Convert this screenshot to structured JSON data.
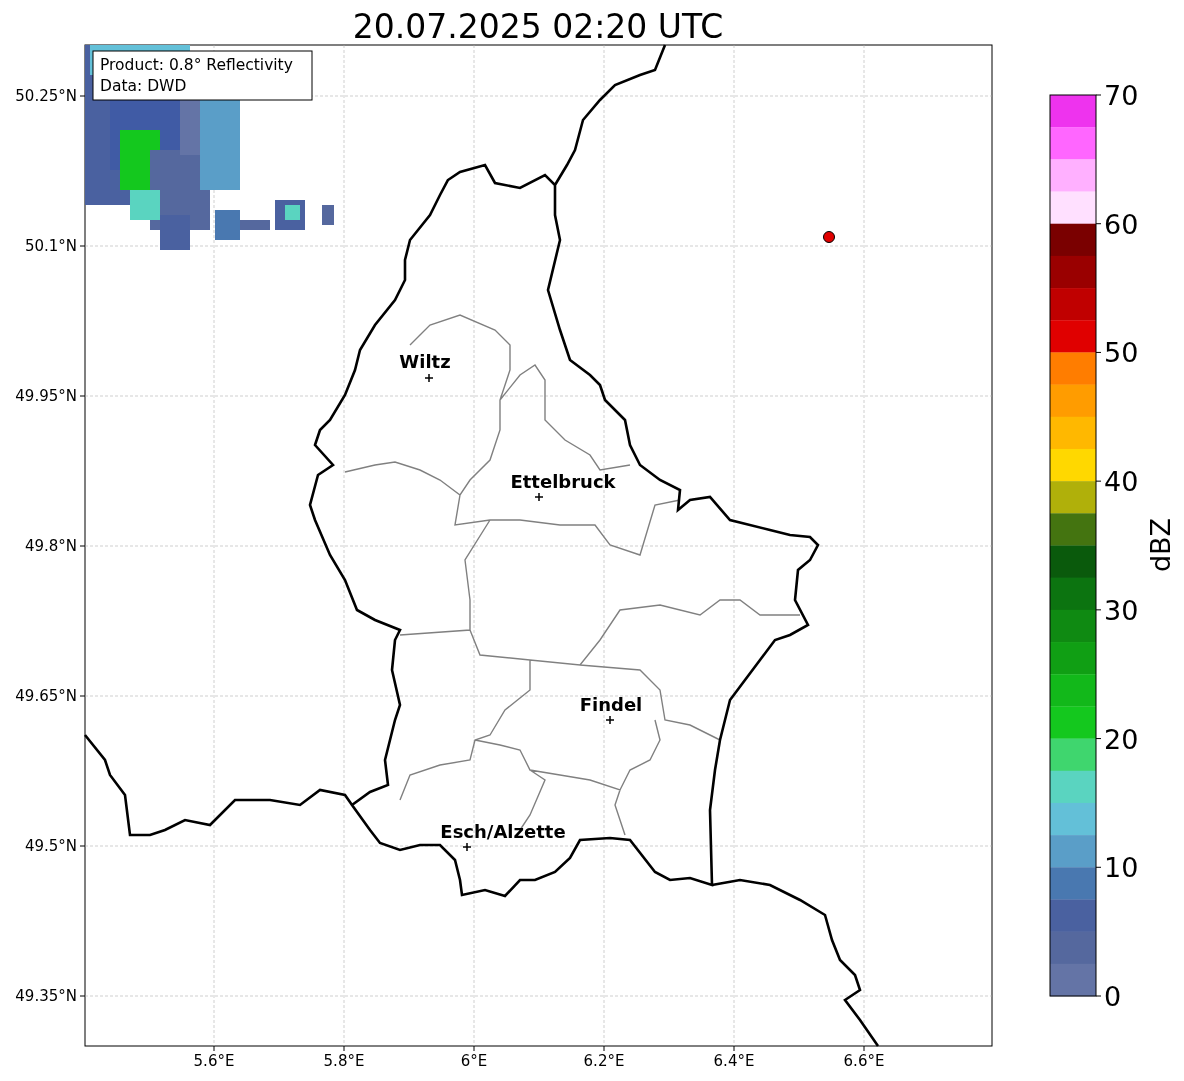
{
  "title": "20.07.2025 02:20 UTC",
  "info_box": [
    "Product: 0.8° Reflectivity",
    "Data: DWD"
  ],
  "x_ticks": [
    "5.6°E",
    "5.8°E",
    "6°E",
    "6.2°E",
    "6.4°E",
    "6.6°E"
  ],
  "y_ticks": [
    "50.25°N",
    "50.1°N",
    "49.95°N",
    "49.8°N",
    "49.65°N",
    "49.5°N",
    "49.35°N"
  ],
  "cities": [
    {
      "name": "Wiltz"
    },
    {
      "name": "Ettelbruck"
    },
    {
      "name": "Findel"
    },
    {
      "name": "Esch/Alzette"
    }
  ],
  "colorbar": {
    "label": "dBZ",
    "ticks": [
      "70",
      "60",
      "50",
      "40",
      "30",
      "20",
      "10",
      "0"
    ],
    "segments": [
      {
        "color": "#ee33ee"
      },
      {
        "color": "#ff66ff"
      },
      {
        "color": "#ffb0ff"
      },
      {
        "color": "#ffe0ff"
      },
      {
        "color": "#7a0000"
      },
      {
        "color": "#9a0000"
      },
      {
        "color": "#c00000"
      },
      {
        "color": "#e00000"
      },
      {
        "color": "#ff7d00"
      },
      {
        "color": "#ff9c00"
      },
      {
        "color": "#ffb800"
      },
      {
        "color": "#ffd800"
      },
      {
        "color": "#b0b00a"
      },
      {
        "color": "#447410"
      },
      {
        "color": "#0a5a0c"
      },
      {
        "color": "#0c7410"
      },
      {
        "color": "#0f8a12"
      },
      {
        "color": "#109f14"
      },
      {
        "color": "#12b81a"
      },
      {
        "color": "#14c81e"
      },
      {
        "color": "#3fd66e"
      },
      {
        "color": "#5ad4c0"
      },
      {
        "color": "#63c0d8"
      },
      {
        "color": "#5a9ec8"
      },
      {
        "color": "#4978b0"
      },
      {
        "color": "#4a61a0"
      },
      {
        "color": "#55689e"
      },
      {
        "color": "#6474a6"
      }
    ]
  }
}
